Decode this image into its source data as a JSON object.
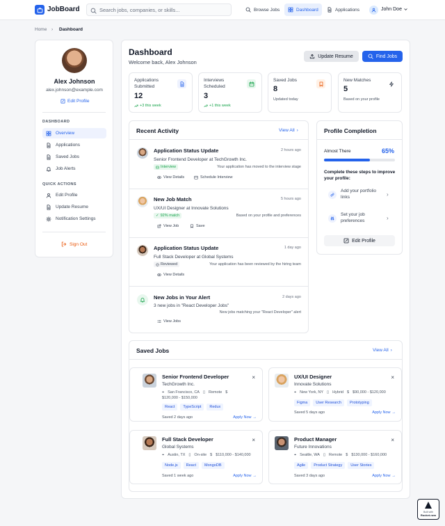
{
  "header": {
    "logo": "JobBoard",
    "search_placeholder": "Search jobs, companies, or skills...",
    "nav": [
      "Browse Jobs",
      "Dashboard",
      "Applications"
    ],
    "user": "John Doe"
  },
  "breadcrumb": [
    "Home",
    "Dashboard"
  ],
  "profile": {
    "name": "Alex Johnson",
    "email": "alex.johnson@example.com",
    "edit": "Edit Profile",
    "dashboard_label": "DASHBOARD",
    "menu": [
      "Overview",
      "Applications",
      "Saved Jobs",
      "Job Alerts"
    ],
    "quick_label": "QUICK ACTIONS",
    "quick": [
      "Edit Profile",
      "Update Resume",
      "Notification Settings"
    ],
    "signout": "Sign Out"
  },
  "main": {
    "title": "Dashboard",
    "welcome": "Welcome back, Alex Johnson",
    "update_resume": "Update Resume",
    "find_jobs": "Find Jobs"
  },
  "stats": [
    {
      "label": "Applications Submitted",
      "value": "12",
      "sub": "+3 this week"
    },
    {
      "label": "Interviews Scheduled",
      "value": "3",
      "sub": "+1 this week"
    },
    {
      "label": "Saved Jobs",
      "value": "8",
      "sub": "Updated today"
    },
    {
      "label": "New Matches",
      "value": "5",
      "sub": "Based on your profile"
    }
  ],
  "activity": {
    "title": "Recent Activity",
    "view_all": "View All",
    "items": [
      {
        "title": "Application Status Update",
        "time": "2 hours ago",
        "desc": "Senior Frontend Developer at TechGrowth Inc.",
        "chip": "Interview",
        "note": "Your application has moved to the interview stage",
        "actions": [
          "View Details",
          "Schedule Interview"
        ]
      },
      {
        "title": "New Job Match",
        "time": "5 hours ago",
        "desc": "UX/UI Designer at Innovate Solutions",
        "chip": "92% match",
        "note": "Based on your profile and preferences",
        "actions": [
          "View Job",
          "Save"
        ]
      },
      {
        "title": "Application Status Update",
        "time": "1 day ago",
        "desc": "Full Stack Developer at Global Systems",
        "chip": "Reviewed",
        "note": "Your application has been reviewed by the hiring team",
        "actions": [
          "View Details"
        ]
      },
      {
        "title": "New Jobs in Your Alert",
        "time": "2 days ago",
        "desc": "3 new jobs in \"React Developer Jobs\"",
        "note": "New jobs matching your \"React Developer\" alert",
        "actions": [
          "View Jobs"
        ]
      }
    ]
  },
  "completion": {
    "title": "Profile Completion",
    "label": "Almost There",
    "percent": "65%",
    "progress": 0.65,
    "steps_title": "Complete these steps to improve your profile:",
    "steps": [
      "Add your portfolio links",
      "Set your job preferences"
    ],
    "button": "Edit Profile"
  },
  "saved": {
    "title": "Saved Jobs",
    "view_all": "View All",
    "jobs": [
      {
        "title": "Senior Frontend Developer",
        "company": "TechGrowth Inc.",
        "location": "San Francisco, CA",
        "type": "Remote",
        "salary": "$120,000 - $150,000",
        "tags": [
          "React",
          "TypeScript",
          "Redux"
        ],
        "saved": "Saved 2 days ago",
        "apply": "Apply Now"
      },
      {
        "title": "UX/UI Designer",
        "company": "Innovate Solutions",
        "location": "New York, NY",
        "type": "Hybrid",
        "salary": "$90,000 - $120,000",
        "tags": [
          "Figma",
          "User Research",
          "Prototyping"
        ],
        "saved": "Saved 5 days ago",
        "apply": "Apply Now"
      },
      {
        "title": "Full Stack Developer",
        "company": "Global Systems",
        "location": "Austin, TX",
        "type": "On-site",
        "salary": "$110,000 - $140,000",
        "tags": [
          "Node.js",
          "React",
          "MongoDB"
        ],
        "saved": "Saved 1 week ago",
        "apply": "Apply Now"
      },
      {
        "title": "Product Manager",
        "company": "Future Innovations",
        "location": "Seattle, WA",
        "type": "Remote",
        "salary": "$130,000 - $160,000",
        "tags": [
          "Agile",
          "Product Strategy",
          "User Stories"
        ],
        "saved": "Saved 3 days ago",
        "apply": "Apply Now"
      }
    ]
  },
  "badge": {
    "line1": "Built with",
    "line2": "Rocket.new"
  },
  "colors": {
    "accent": "#2563eb",
    "success": "#16a34a",
    "warning": "#ea580c"
  }
}
